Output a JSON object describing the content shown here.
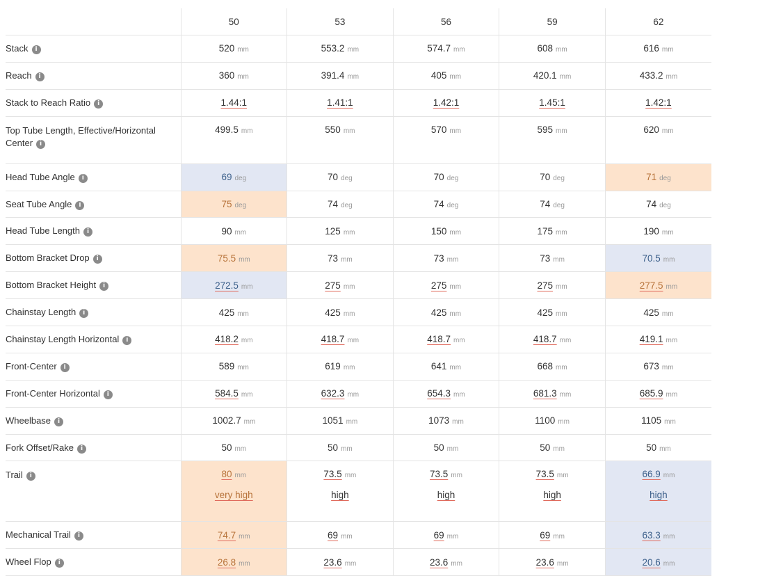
{
  "sizes": [
    "50",
    "53",
    "56",
    "59",
    "62"
  ],
  "rows": [
    {
      "label": "Stack",
      "unit": "mm",
      "values": [
        "520",
        "553.2",
        "574.7",
        "608",
        "616"
      ]
    },
    {
      "label": "Reach",
      "unit": "mm",
      "values": [
        "360",
        "391.4",
        "405",
        "420.1",
        "433.2"
      ]
    },
    {
      "label": "Stack to Reach Ratio",
      "unit": "",
      "values": [
        "1.44:1",
        "1.41:1",
        "1.42:1",
        "1.45:1",
        "1.42:1"
      ]
    },
    {
      "label": "Top Tube Length, Effective/Horizontal Center",
      "unit": "mm",
      "values": [
        "499.5",
        "550",
        "570",
        "595",
        "620"
      ]
    },
    {
      "label": "Head Tube Angle",
      "unit": "deg",
      "values": [
        "69",
        "70",
        "70",
        "70",
        "71"
      ],
      "highlights": [
        "low",
        "",
        "",
        "",
        "high"
      ]
    },
    {
      "label": "Seat Tube Angle",
      "unit": "deg",
      "values": [
        "75",
        "74",
        "74",
        "74",
        "74"
      ],
      "highlights": [
        "high",
        "",
        "",
        "",
        ""
      ]
    },
    {
      "label": "Head Tube Length",
      "unit": "mm",
      "values": [
        "90",
        "125",
        "150",
        "175",
        "190"
      ]
    },
    {
      "label": "Bottom Bracket Drop",
      "unit": "mm",
      "values": [
        "75.5",
        "73",
        "73",
        "73",
        "70.5"
      ],
      "highlights": [
        "high",
        "",
        "",
        "",
        "low"
      ]
    },
    {
      "label": "Bottom Bracket Height",
      "unit": "mm",
      "values": [
        "272.5",
        "275",
        "275",
        "275",
        "277.5"
      ],
      "highlights": [
        "low",
        "",
        "",
        "",
        "high"
      ]
    },
    {
      "label": "Chainstay Length",
      "unit": "mm",
      "values": [
        "425",
        "425",
        "425",
        "425",
        "425"
      ]
    },
    {
      "label": "Chainstay Length Horizontal",
      "unit": "mm",
      "values": [
        "418.2",
        "418.7",
        "418.7",
        "418.7",
        "419.1"
      ]
    },
    {
      "label": "Front-Center",
      "unit": "mm",
      "values": [
        "589",
        "619",
        "641",
        "668",
        "673"
      ]
    },
    {
      "label": "Front-Center Horizontal",
      "unit": "mm",
      "values": [
        "584.5",
        "632.3",
        "654.3",
        "681.3",
        "685.9"
      ]
    },
    {
      "label": "Wheelbase",
      "unit": "mm",
      "values": [
        "1002.7",
        "1051",
        "1073",
        "1100",
        "1105"
      ]
    },
    {
      "label": "Fork Offset/Rake",
      "unit": "mm",
      "values": [
        "50",
        "50",
        "50",
        "50",
        "50"
      ]
    },
    {
      "label": "Trail",
      "unit": "mm",
      "values": [
        "80",
        "73.5",
        "73.5",
        "73.5",
        "66.9"
      ],
      "highlights": [
        "high",
        "",
        "",
        "",
        "low"
      ],
      "descriptors": [
        "very high",
        "high",
        "high",
        "high",
        "high"
      ]
    },
    {
      "label": "Mechanical Trail",
      "unit": "mm",
      "values": [
        "74.7",
        "69",
        "69",
        "69",
        "63.3"
      ],
      "highlights": [
        "high",
        "",
        "",
        "",
        "low"
      ]
    },
    {
      "label": "Wheel Flop",
      "unit": "mm",
      "values": [
        "26.8",
        "23.6",
        "23.6",
        "23.6",
        "20.6"
      ],
      "highlights": [
        "high",
        "",
        "",
        "",
        "low"
      ]
    }
  ],
  "info_glyph": "i",
  "icons": {
    "info": "info-icon"
  },
  "colors": {
    "high_bg": "#fde3cc",
    "high_text": "#b7733a",
    "low_bg": "#e2e7f3",
    "low_text": "#3b5f8a",
    "underline": "#e06a5c"
  }
}
